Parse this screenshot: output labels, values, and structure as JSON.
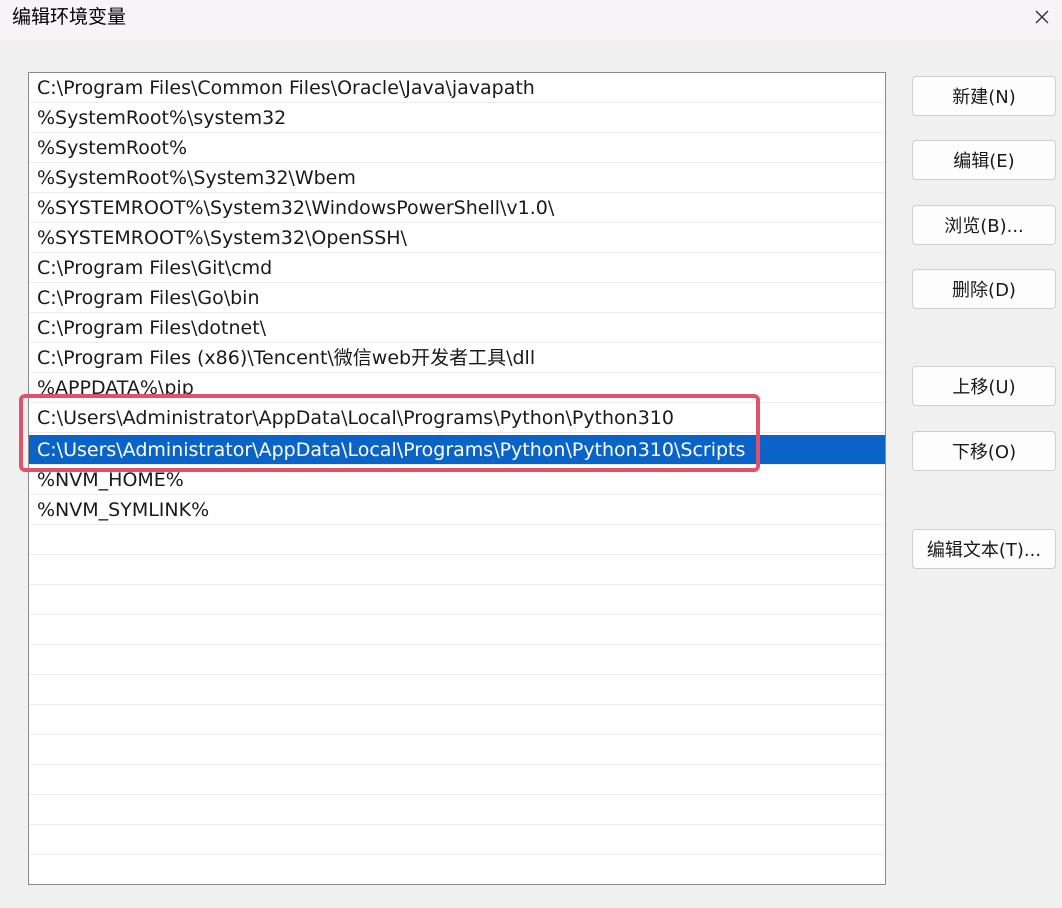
{
  "window": {
    "title": "编辑环境变量"
  },
  "list": {
    "items": [
      "C:\\Program Files\\Common Files\\Oracle\\Java\\javapath",
      "%SystemRoot%\\system32",
      "%SystemRoot%",
      "%SystemRoot%\\System32\\Wbem",
      "%SYSTEMROOT%\\System32\\WindowsPowerShell\\v1.0\\",
      "%SYSTEMROOT%\\System32\\OpenSSH\\",
      "C:\\Program Files\\Git\\cmd",
      "C:\\Program Files\\Go\\bin",
      "C:\\Program Files\\dotnet\\",
      "C:\\Program Files (x86)\\Tencent\\微信web开发者工具\\dll",
      "%APPDATA%\\pip",
      "C:\\Users\\Administrator\\AppData\\Local\\Programs\\Python\\Python310",
      "C:\\Users\\Administrator\\AppData\\Local\\Programs\\Python\\Python310\\Scripts",
      "%NVM_HOME%",
      "%NVM_SYMLINK%"
    ],
    "selected_index": 12,
    "highlighted_indices": [
      11,
      12
    ]
  },
  "buttons": {
    "new": "新建(N)",
    "edit": "编辑(E)",
    "browse": "浏览(B)...",
    "delete": "删除(D)",
    "move_up": "上移(U)",
    "move_down": "下移(O)",
    "edit_text": "编辑文本(T)..."
  },
  "colors": {
    "selection": "#0a64c8",
    "highlight_border": "#e0526a"
  }
}
